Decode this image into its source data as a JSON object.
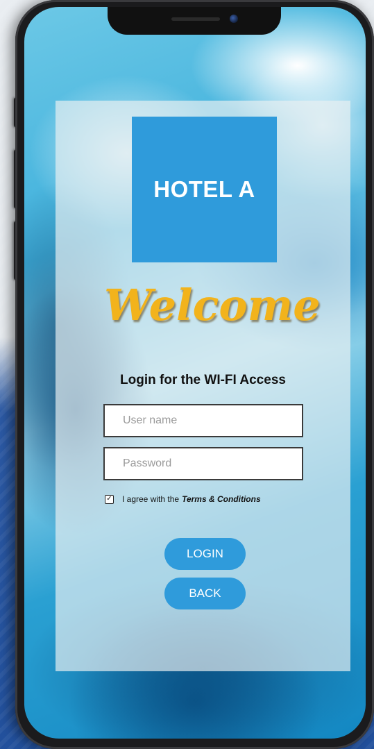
{
  "hotel": {
    "logo_text": "HOTEL A"
  },
  "welcome": {
    "heading": "Welcome"
  },
  "login": {
    "subtitle": "Login for the WI-FI Access",
    "username_placeholder": "User name",
    "password_placeholder": "Password",
    "agree_text": "I agree with the",
    "terms_link": "Terms & Conditions",
    "agree_checked": true,
    "login_label": "LOGIN",
    "back_label": "BACK"
  },
  "colors": {
    "accent": "#2f9bdb",
    "welcome_gold": "#f2b31c"
  },
  "icons": {
    "checkbox_mark": "check-icon"
  }
}
